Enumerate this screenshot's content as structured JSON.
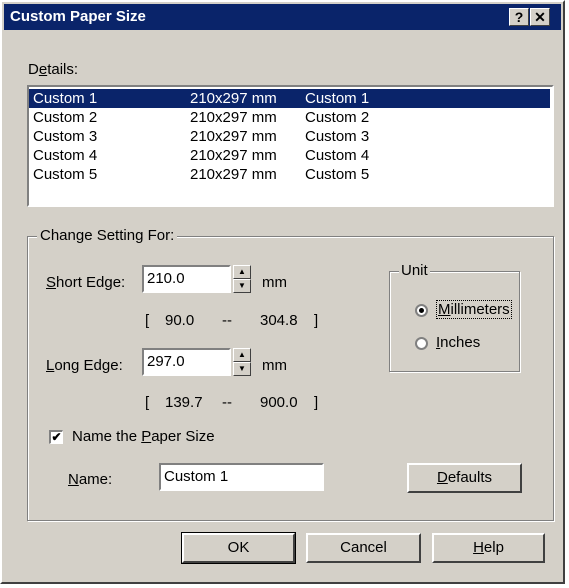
{
  "window": {
    "title": "Custom Paper Size",
    "help_button": "?",
    "close_button": "✕"
  },
  "details": {
    "label_prefix": "D",
    "label_ul": "e",
    "label_suffix": "tails:",
    "rows": [
      {
        "name": "Custom 1",
        "size": "210x297 mm",
        "desc": "Custom 1",
        "selected": true
      },
      {
        "name": "Custom 2",
        "size": "210x297 mm",
        "desc": "Custom 2",
        "selected": false
      },
      {
        "name": "Custom 3",
        "size": "210x297 mm",
        "desc": "Custom 3",
        "selected": false
      },
      {
        "name": "Custom 4",
        "size": "210x297 mm",
        "desc": "Custom 4",
        "selected": false
      },
      {
        "name": "Custom 5",
        "size": "210x297 mm",
        "desc": "Custom 5",
        "selected": false
      }
    ]
  },
  "settings": {
    "group_label": "Change Setting For:",
    "short_edge": {
      "label_ul": "S",
      "label_rest": "hort Edge:",
      "value": "210.0",
      "unit": "mm",
      "range_open": "[",
      "range_min": "90.0",
      "range_sep": "--",
      "range_max": "304.8",
      "range_close": "]"
    },
    "long_edge": {
      "label_ul": "L",
      "label_rest": "ong Edge:",
      "value": "297.0",
      "unit": "mm",
      "range_open": "[",
      "range_min": "139.7",
      "range_sep": "--",
      "range_max": "900.0",
      "range_close": "]"
    },
    "unit": {
      "group_label": "Unit",
      "millimeters_ul": "M",
      "millimeters_rest": "illimeters",
      "inches_ul": "I",
      "inches_rest": "nches",
      "selected": "millimeters"
    },
    "name_checkbox": {
      "label_prefix": "Name the ",
      "label_ul": "P",
      "label_suffix": "aper Size",
      "checked": true,
      "check_glyph": "✔"
    },
    "name_field": {
      "label_ul": "N",
      "label_rest": "ame:",
      "value": "Custom 1"
    },
    "defaults_ul": "D",
    "defaults_rest": "efaults"
  },
  "buttons": {
    "ok": "OK",
    "cancel": "Cancel",
    "help_ul": "H",
    "help_rest": "elp"
  },
  "icons": {
    "spin_up": "▲",
    "spin_down": "▼"
  },
  "colors": {
    "face": "#d4d0c8",
    "titlebar": "#0a246a",
    "selection": "#0a246a"
  }
}
